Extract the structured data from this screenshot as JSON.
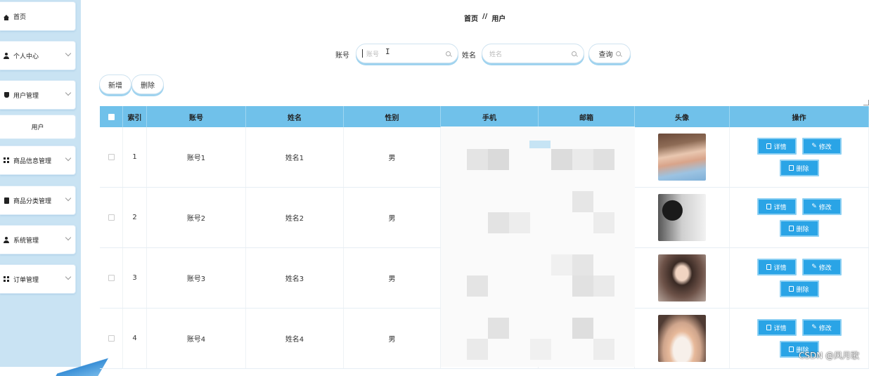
{
  "sidebar": {
    "items": [
      {
        "label": "首页",
        "icon": "home-icon"
      },
      {
        "label": "个人中心",
        "icon": "user-icon"
      },
      {
        "label": "用户管理",
        "icon": "vase-icon"
      },
      {
        "label": "用户",
        "icon": ""
      },
      {
        "label": "商品信息管理",
        "icon": "grid-icon"
      },
      {
        "label": "商品分类管理",
        "icon": "clipboard-icon"
      },
      {
        "label": "系统管理",
        "icon": "user-icon"
      },
      {
        "label": "订单管理",
        "icon": "grid-icon"
      }
    ]
  },
  "breadcrumb": {
    "home": "首页",
    "sep": "//",
    "current": "用户"
  },
  "search": {
    "account_label": "账号",
    "account_placeholder": "账号",
    "name_label": "姓名",
    "name_placeholder": "姓名",
    "query_label": "查询"
  },
  "actions": {
    "add": "新增",
    "delete": "删除"
  },
  "table": {
    "headers": [
      "索引",
      "账号",
      "姓名",
      "性别",
      "手机",
      "邮箱",
      "头像",
      "操作"
    ],
    "rows": [
      {
        "index": "1",
        "account": "账号1",
        "name": "姓名1",
        "gender": "男"
      },
      {
        "index": "2",
        "account": "账号2",
        "name": "姓名2",
        "gender": "男"
      },
      {
        "index": "3",
        "account": "账号3",
        "name": "姓名3",
        "gender": "男"
      },
      {
        "index": "4",
        "account": "账号4",
        "name": "姓名4",
        "gender": "男"
      }
    ],
    "row_actions": {
      "detail": "详情",
      "edit": "修改",
      "delete": "删除"
    }
  },
  "watermark": "CSDN @风月歌",
  "colors": {
    "header_bg": "#70c1ea",
    "button_blue": "#2aa4e6",
    "sidebar_bg": "#c9e3f3"
  }
}
